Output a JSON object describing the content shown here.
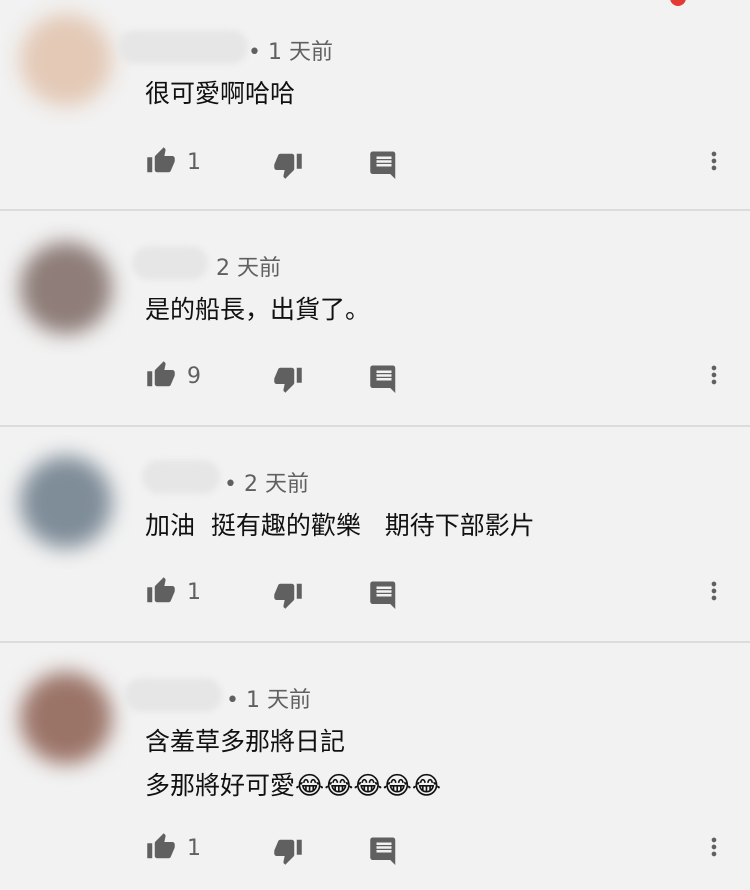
{
  "comments": [
    {
      "time": "• 1 天前",
      "text": "很可愛啊哈哈",
      "likes": "1",
      "avatar_color": "#e3c9b6"
    },
    {
      "time": "2 天前",
      "text": "是的船長，出貨了。",
      "likes": "9",
      "avatar_color": "#8e7d78"
    },
    {
      "time": "• 2 天前",
      "text": "加油  挺有趣的歡樂   期待下部影片",
      "likes": "1",
      "avatar_color": "#7f8d99"
    },
    {
      "time": "• 1 天前",
      "text": "含羞草多那將日記\n多那將好可愛😂😂😂😂😂",
      "likes": "1",
      "avatar_color": "#9b7468"
    }
  ],
  "icons": {
    "like": "thumb-up-icon",
    "dislike": "thumb-down-icon",
    "reply": "comment-icon",
    "more": "more-vert-icon"
  },
  "colors": {
    "icon": "#606060",
    "background": "#f2f2f2",
    "divider": "#dcdcdc"
  }
}
